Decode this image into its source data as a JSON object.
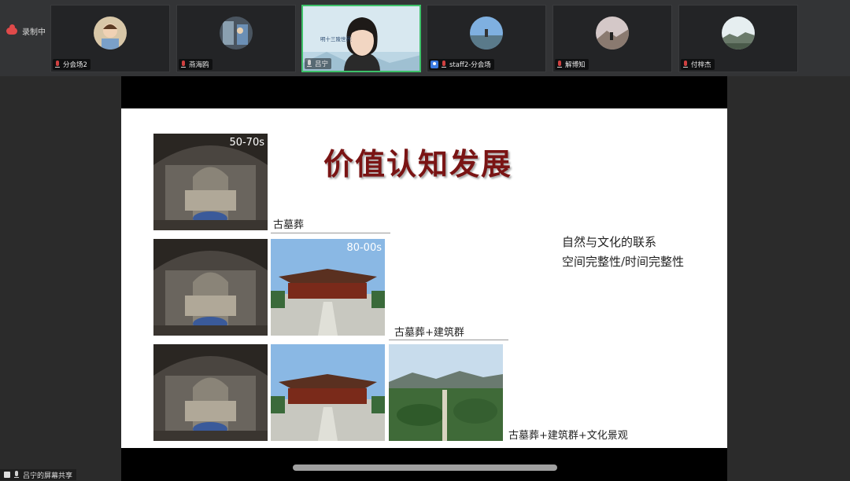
{
  "recording": {
    "label": "录制中"
  },
  "participants": [
    {
      "name": "分会场2",
      "mic_muted": true
    },
    {
      "name": "燕海鸥",
      "mic_muted": true
    },
    {
      "name": "吕宁",
      "mic_muted": false,
      "active": true,
      "banner_title": "明十三陵世界遗产的价值认知与文化利用"
    },
    {
      "name": "staff2-分会场",
      "mic_muted": true
    },
    {
      "name": "解博知",
      "mic_muted": true
    },
    {
      "name": "付梓杰",
      "mic_muted": true
    }
  ],
  "slide": {
    "title": "价值认知发展",
    "rows": [
      {
        "era": "50-70s",
        "caption": "古墓葬"
      },
      {
        "era": "80-00s",
        "caption": "古墓葬+建筑群"
      },
      {
        "era": "",
        "caption": "古墓葬+建筑群+文化景观"
      }
    ],
    "notes": [
      "自然与文化的联系",
      "空间完整性/时间完整性"
    ]
  },
  "share_bar": {
    "label": "吕宁的屏幕共享"
  },
  "colors": {
    "title": "#7a1414",
    "active_border": "#3ec16a"
  }
}
